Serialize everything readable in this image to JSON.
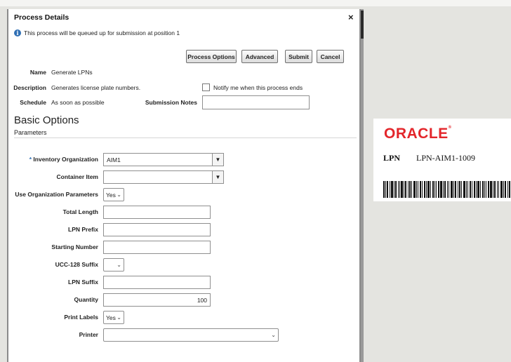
{
  "dialog": {
    "title": "Process Details",
    "close": "×",
    "info_message": "This process will be queued up for submission at position 1",
    "buttons": {
      "process_options": "Process Options",
      "advanced": "Advanced",
      "submit": "Submit",
      "cancel": "Cancel"
    },
    "details": {
      "name_label": "Name",
      "name_value": "Generate LPNs",
      "description_label": "Description",
      "description_value": "Generates license plate numbers.",
      "schedule_label": "Schedule",
      "schedule_value": "As soon as possible",
      "notify_label": "Notify me when this process ends",
      "notify_checked": false,
      "submission_notes_label": "Submission Notes",
      "submission_notes_value": ""
    },
    "section_title": "Basic Options",
    "section_subtitle": "Parameters",
    "parameters": {
      "required_marker": "*",
      "inventory_org_label": "Inventory Organization",
      "inventory_org_value": "AIM1",
      "container_item_label": "Container Item",
      "container_item_value": "",
      "use_org_params_label": "Use Organization Parameters",
      "use_org_params_value": "Yes",
      "total_length_label": "Total Length",
      "total_length_value": "",
      "lpn_prefix_label": "LPN Prefix",
      "lpn_prefix_value": "",
      "starting_number_label": "Starting Number",
      "starting_number_value": "",
      "ucc_suffix_label": "UCC-128 Suffix",
      "ucc_suffix_value": "",
      "lpn_suffix_label": "LPN Suffix",
      "lpn_suffix_value": "",
      "quantity_label": "Quantity",
      "quantity_value": "100",
      "print_labels_label": "Print Labels",
      "print_labels_value": "Yes",
      "printer_label": "Printer",
      "printer_value": ""
    }
  },
  "label_card": {
    "brand": "ORACLE",
    "lpn_label": "LPN",
    "lpn_value": "LPN-AIM1-1009"
  },
  "icons": {
    "info": "info-icon",
    "close": "close-icon",
    "dropdown": "triangle-down-icon",
    "chevron": "chevron-down-icon",
    "barcode": "barcode-image"
  },
  "colors": {
    "brand_red": "#e3262b",
    "info_blue": "#2f6fb4"
  }
}
